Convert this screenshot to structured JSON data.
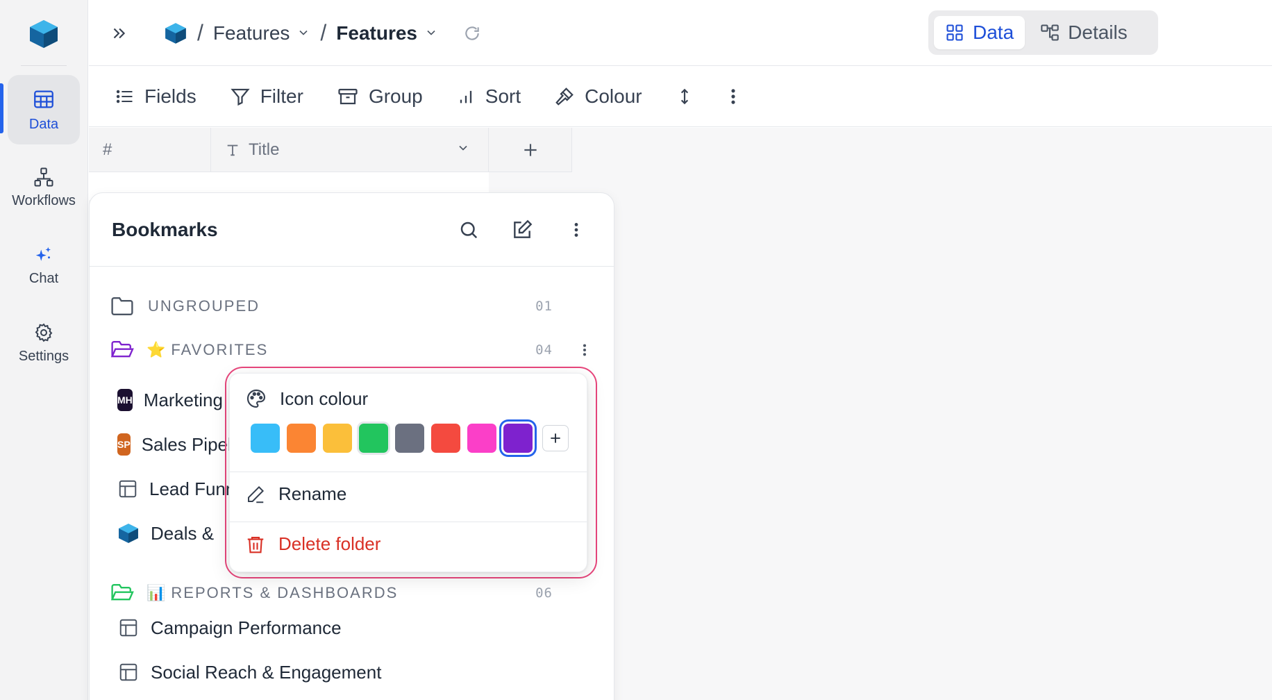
{
  "rail": {
    "items": [
      {
        "label": "Data",
        "icon": "table-icon",
        "active": true
      },
      {
        "label": "Workflows",
        "icon": "workflow-icon"
      },
      {
        "label": "Chat",
        "icon": "sparkle-icon"
      },
      {
        "label": "Settings",
        "icon": "gear-icon"
      }
    ]
  },
  "breadcrumb": {
    "items": [
      "Features",
      "Features"
    ]
  },
  "view_toggle": {
    "data_label": "Data",
    "details_label": "Details",
    "active": "Data"
  },
  "toolbar": {
    "fields": "Fields",
    "filter": "Filter",
    "group": "Group",
    "sort": "Sort",
    "colour": "Colour"
  },
  "table": {
    "columns": [
      "#",
      "Title"
    ]
  },
  "bookmarks": {
    "title": "Bookmarks",
    "groups": [
      {
        "label": "UNGROUPED",
        "count": "01",
        "emoji": ""
      },
      {
        "label": "FAVORITES",
        "count": "04",
        "emoji": "⭐"
      },
      {
        "label": "REPORTS & DASHBOARDS",
        "count": "06",
        "emoji": "📊"
      }
    ],
    "favorites": [
      {
        "label": "Marketing Hub",
        "badge": "MH",
        "badge_color": "#1b1030"
      },
      {
        "label": "Sales Pipeline",
        "badge": "SP",
        "badge_color": "#d0651f"
      },
      {
        "label": "Lead Funnel",
        "badge": "",
        "icon": "table-icon"
      },
      {
        "label": "Deals & ",
        "badge": "",
        "icon": "cube-icon"
      }
    ],
    "reports": [
      {
        "label": "Campaign Performance",
        "icon": "table-icon"
      },
      {
        "label": "Social Reach & Engagement",
        "icon": "table-icon"
      }
    ]
  },
  "context_menu": {
    "icon_colour_label": "Icon colour",
    "swatches": [
      "#38bdf8",
      "#fb8533",
      "#fbbf3a",
      "#22c55e",
      "#6b7080",
      "#f44a3f",
      "#fb3fc8",
      "#7e22ce"
    ],
    "selected_swatch": "#7e22ce",
    "rename": "Rename",
    "delete": "Delete folder"
  },
  "colors": {
    "accent": "#2563eb",
    "danger": "#d93025",
    "folder_purple": "#7e22ce",
    "folder_green": "#22c55e"
  }
}
